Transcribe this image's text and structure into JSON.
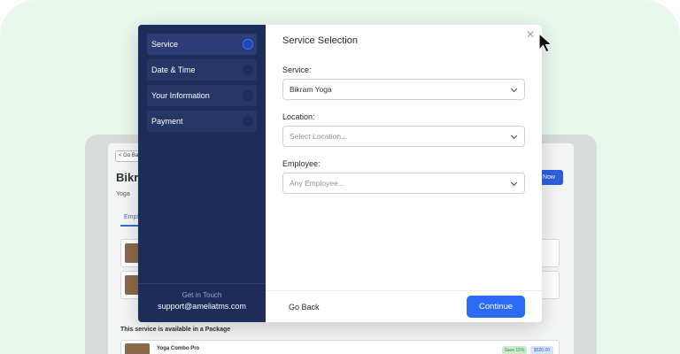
{
  "background": {
    "go_back": "< Go Back",
    "title": "Bikram",
    "category": "Yoga",
    "tab": "Employees",
    "book_now": "Now",
    "package_label": "This service is available in a Package",
    "package_name": "Yoga Combo Pro",
    "save_badge": "Save 15%",
    "price_badge": "$520.00"
  },
  "sidebar": {
    "steps": [
      {
        "label": "Service",
        "active": true
      },
      {
        "label": "Date & Time",
        "active": false
      },
      {
        "label": "Your Information",
        "active": false
      },
      {
        "label": "Payment",
        "active": false
      }
    ],
    "footer_label": "Get in Touch",
    "footer_email": "support@ameliatms.com"
  },
  "content": {
    "title": "Service Selection",
    "service_label": "Service:",
    "service_value": "Bikram Yoga",
    "location_label": "Location:",
    "location_placeholder": "Select Location...",
    "employee_label": "Employee:",
    "employee_placeholder": "Any Employee..."
  },
  "footer": {
    "back_label": "Go Back",
    "continue_label": "Continue"
  },
  "icons": {
    "close": "close-icon",
    "chevron": "chevron-down-icon",
    "cursor": "mouse-cursor-icon"
  },
  "colors": {
    "canvas": "#e9f8ec",
    "sidebar": "#1d2c59",
    "primary": "#2b6af2"
  }
}
